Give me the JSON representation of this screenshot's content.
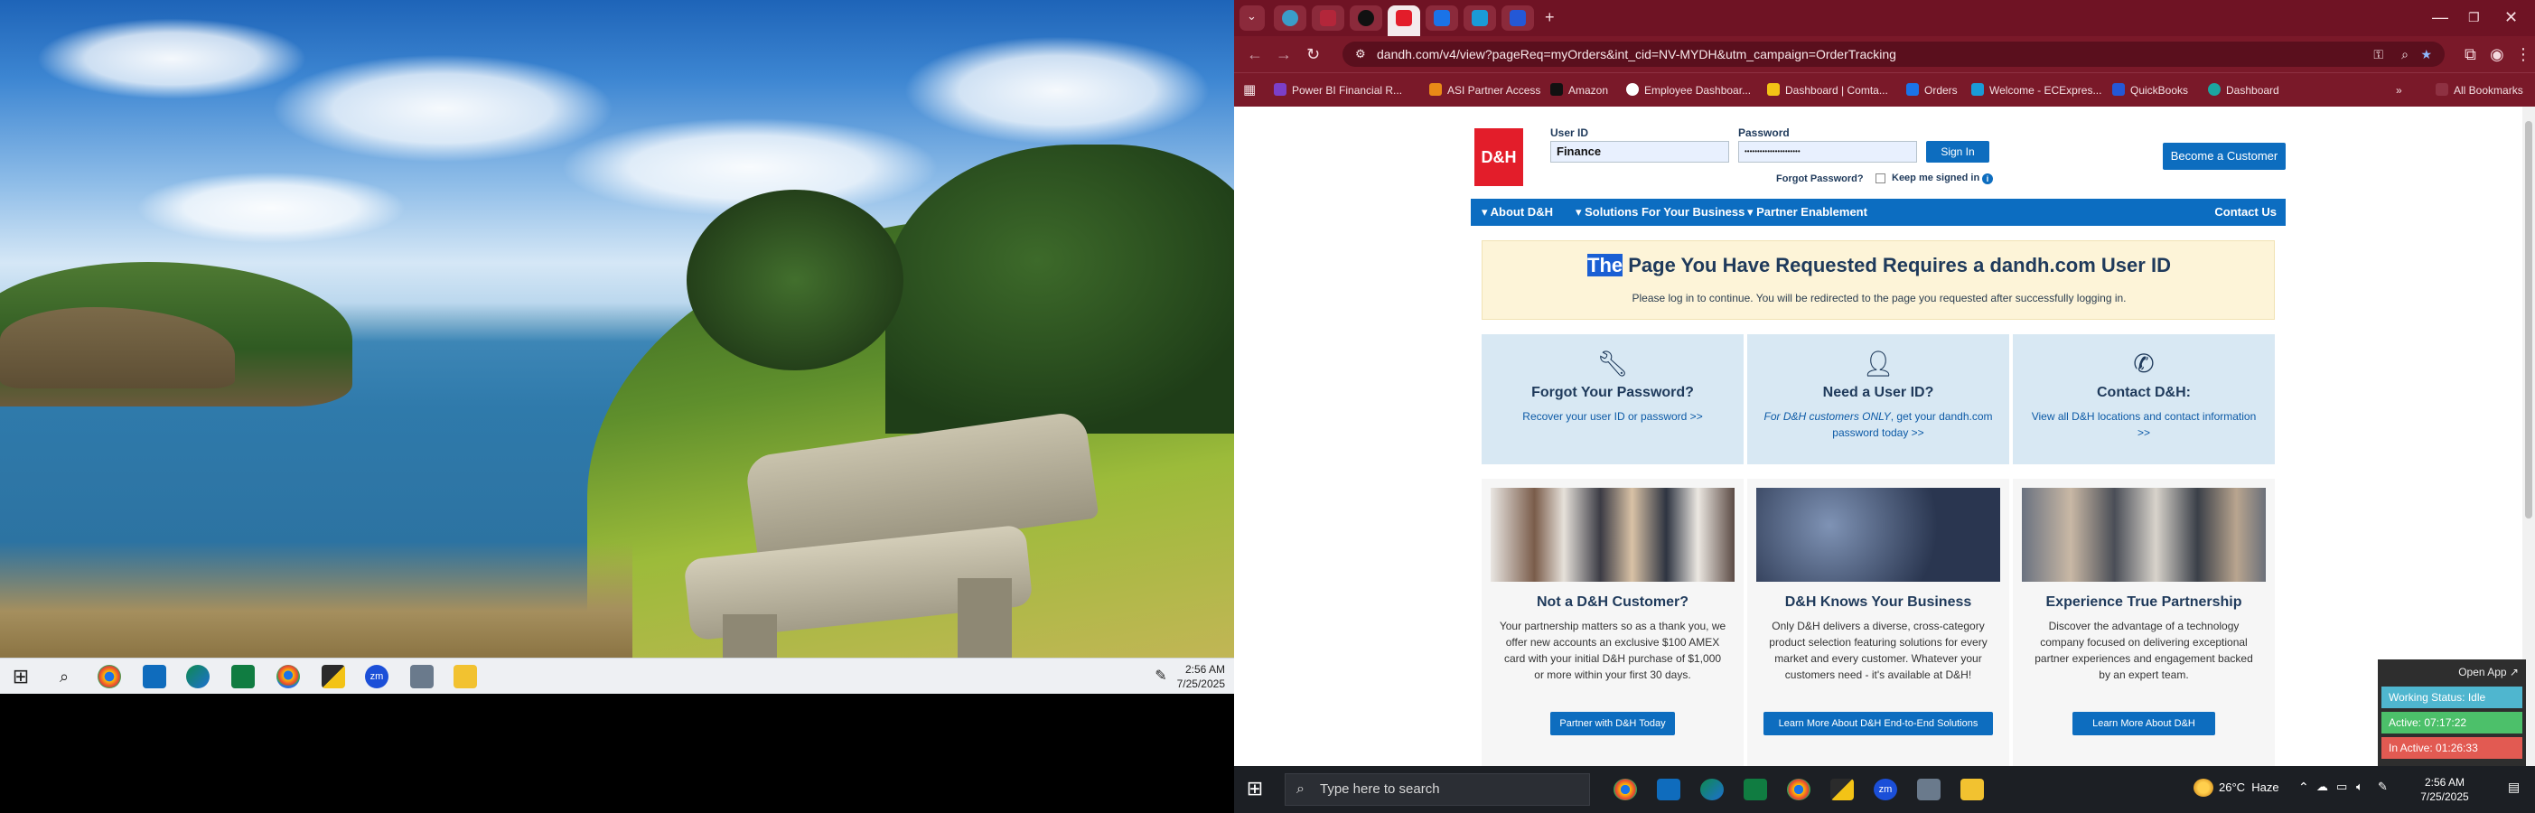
{
  "left_taskbar": {
    "time": "2:56 AM",
    "date": "7/25/2025"
  },
  "browser": {
    "url": "dandh.com/v4/view?pageReq=myOrders&int_cid=NV-MYDH&utm_campaign=OrderTracking",
    "bookmarks": [
      "Power BI Financial R...",
      "ASI Partner Access",
      "Amazon",
      "Employee Dashboar...",
      "Dashboard | Comta...",
      "Orders",
      "Welcome - ECExpres...",
      "QuickBooks",
      "Dashboard"
    ],
    "all_bookmarks": "All Bookmarks"
  },
  "login": {
    "logo": "D&H",
    "user_label": "User ID",
    "user_value": "Finance",
    "password_label": "Password",
    "password_value": "••••••••••••••••••••••",
    "sign_in": "Sign In",
    "forgot": "Forgot Password?",
    "keep": "Keep me signed in",
    "become": "Become a Customer"
  },
  "nav": {
    "items": [
      "About D&H",
      "Solutions For Your Business",
      "Partner Enablement"
    ],
    "contact": "Contact Us"
  },
  "alert": {
    "title_sel": "The",
    "title_rest": " Page You Have Requested Requires a dandh.com User ID",
    "subtitle": "Please log in to continue. You will be redirected to the page you requested after successfully logging in."
  },
  "cards": [
    {
      "title": "Forgot Your Password?",
      "link": "Recover your user ID or password >>",
      "icon": "key-icon"
    },
    {
      "title": "Need a User ID?",
      "link_italic": "For D&H customers ONLY",
      "link": ", get your dandh.com password today >>",
      "icon": "user-icon"
    },
    {
      "title": "Contact D&H:",
      "link": "View all D&H locations and contact information >>",
      "icon": "phone-icon"
    }
  ],
  "promos": [
    {
      "title": "Not a D&H Customer?",
      "text": "Your partnership matters so as a thank you, we offer new accounts an exclusive $100 AMEX card with your initial D&H purchase of $1,000 or more within your first 30 days.",
      "button": "Partner with D&H Today"
    },
    {
      "title": "D&H Knows Your Business",
      "text": "Only D&H delivers a diverse, cross-category product selection featuring solutions for every market and every customer. Whatever your customers need - it's available at D&H!",
      "button": "Learn More About D&H End-to-End Solutions"
    },
    {
      "title": "Experience True Partnership",
      "text": "Discover the advantage of a technology company focused on delivering exceptional partner experiences and engagement backed by an expert team.",
      "button": "Learn More About D&H"
    }
  ],
  "widget": {
    "open": "Open App ↗",
    "status": "Working Status: Idle",
    "active": "Active: 07:17:22",
    "inactive": "In Active: 01:26:33"
  },
  "right_taskbar": {
    "search": "Type here to search",
    "weather": "26°C  Haze",
    "time": "2:56 AM",
    "date": "7/25/2025"
  },
  "colors": {
    "tab_bar": "#6f1324",
    "toolbar": "#7a1929",
    "brand_red": "#e31d2a",
    "nav_blue": "#0c6dc1",
    "alert_bg": "#fdf4d8",
    "card_bg": "#d8e8f3"
  }
}
